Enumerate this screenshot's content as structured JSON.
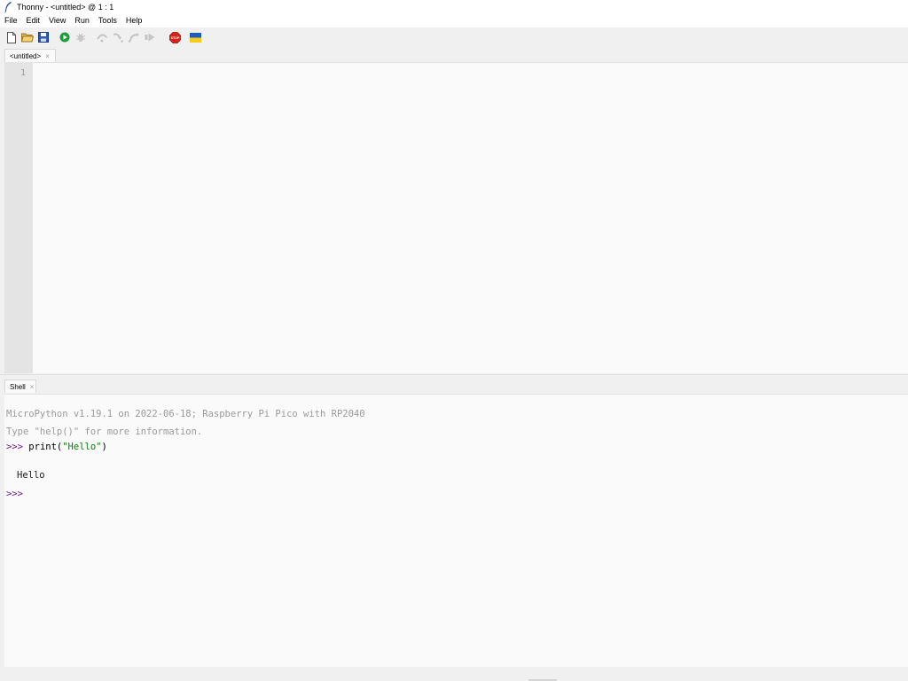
{
  "window": {
    "title": "Thonny  -  <untitled>  @  1 : 1"
  },
  "menu": [
    {
      "label": "File"
    },
    {
      "label": "Edit"
    },
    {
      "label": "View"
    },
    {
      "label": "Run"
    },
    {
      "label": "Tools"
    },
    {
      "label": "Help"
    }
  ],
  "toolbar": {
    "buttons": [
      {
        "name": "new-file-icon",
        "enabled": true
      },
      {
        "name": "open-file-icon",
        "enabled": true
      },
      {
        "name": "save-file-icon",
        "enabled": true
      },
      {
        "name": "run-icon",
        "enabled": true
      },
      {
        "name": "debug-icon",
        "enabled": false
      },
      {
        "name": "step-over-icon",
        "enabled": false
      },
      {
        "name": "step-into-icon",
        "enabled": false
      },
      {
        "name": "step-out-icon",
        "enabled": false
      },
      {
        "name": "resume-icon",
        "enabled": false
      },
      {
        "name": "stop-icon",
        "enabled": true,
        "text": "STOP"
      },
      {
        "name": "ukraine-flag-icon",
        "enabled": true
      }
    ]
  },
  "editor": {
    "tab_label": "<untitled>",
    "close_glyph": "×",
    "line_numbers": [
      "1"
    ],
    "content": ""
  },
  "shell": {
    "tab_label": "Shell",
    "close_glyph": "×",
    "banner": "MicroPython v1.19.1 on 2022-06-18; Raspberry Pi Pico with RP2040",
    "help_hint": "Type \"help()\" for more information.",
    "prompt": ">>>",
    "command_prefix": "print(",
    "command_string": "\"Hello\"",
    "command_suffix": ")",
    "output": "Hello"
  },
  "colors": {
    "prompt": "#6a1a8a",
    "string": "#0a7d0a",
    "run_green": "#1e9e3a",
    "stop_red": "#d9241c"
  }
}
